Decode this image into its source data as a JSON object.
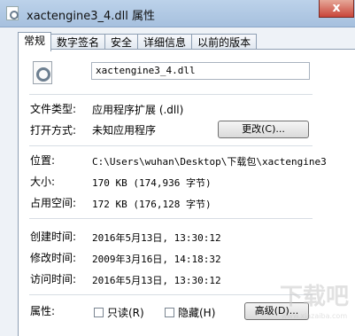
{
  "window": {
    "title": "xactengine3_4.dll 属性",
    "close_glyph": "x"
  },
  "tabs": [
    "常规",
    "数字签名",
    "安全",
    "详细信息",
    "以前的版本"
  ],
  "file": {
    "name": "xactengine3_4.dll",
    "icon": "dll-file-icon"
  },
  "general": {
    "type_label": "文件类型:",
    "type_value": "应用程序扩展 (.dll)",
    "opens_label": "打开方式:",
    "opens_value": "未知应用程序",
    "change_button": "更改(C)...",
    "location_label": "位置:",
    "location_value": "C:\\Users\\wuhan\\Desktop\\下载包\\xactengine3",
    "size_label": "大小:",
    "size_value": "170 KB (174,936 字节)",
    "disk_label": "占用空间:",
    "disk_value": "172 KB (176,128 字节)",
    "created_label": "创建时间:",
    "created_value": "2016年5月13日, 13:30:12",
    "modified_label": "修改时间:",
    "modified_value": "2009年3月16日, 14:18:32",
    "accessed_label": "访问时间:",
    "accessed_value": "2016年5月13日, 13:30:12",
    "attributes_label": "属性:",
    "readonly_label": "只读(R)",
    "hidden_label": "隐藏(H)",
    "advanced_button": "高级(D)..."
  },
  "watermark": {
    "text": "下载吧",
    "url": "www.xiazaiba.com"
  }
}
